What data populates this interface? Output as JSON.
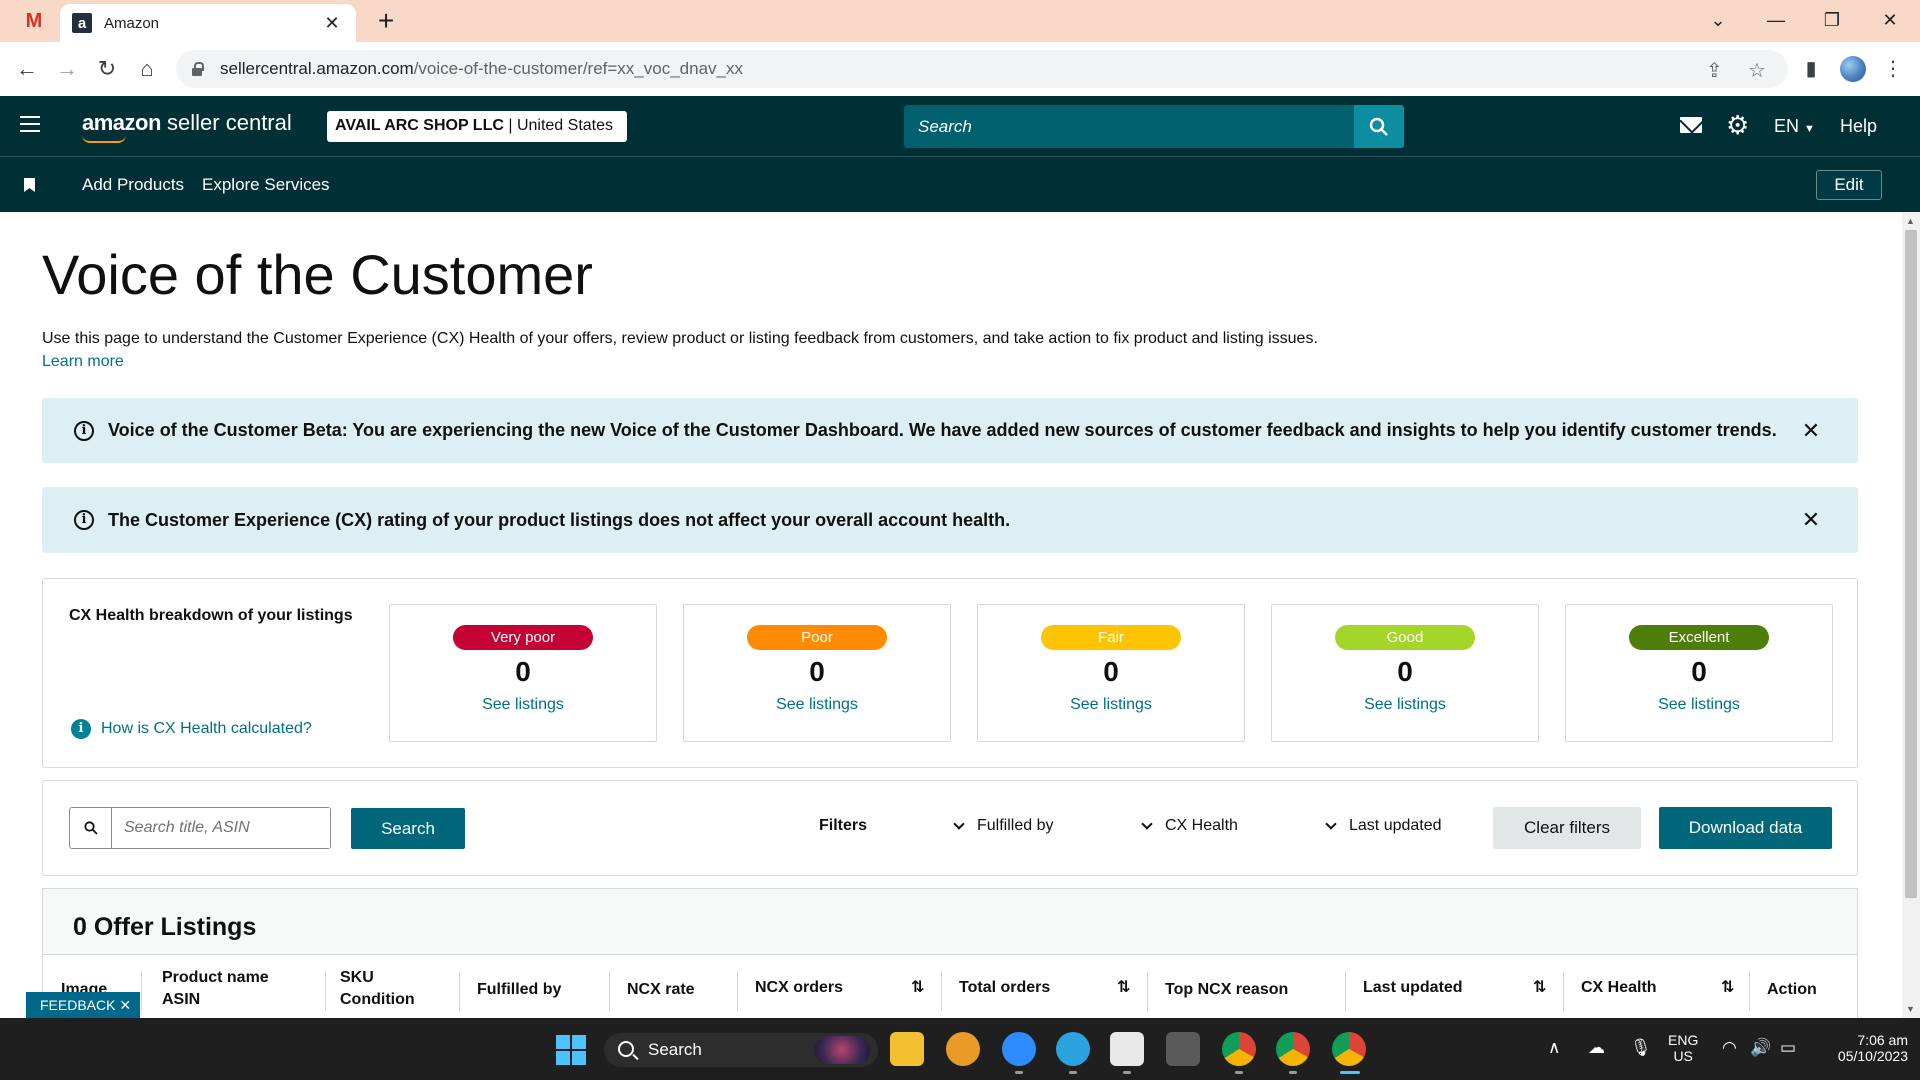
{
  "browser": {
    "tab_title": "Amazon",
    "favicon_letter": "a",
    "gmail_letter": "M",
    "url_host": "sellercentral.amazon.com",
    "url_path": "/voice-of-the-customer/ref=xx_voc_dnav_xx"
  },
  "header": {
    "logo_brand": "amazon",
    "logo_suffix": " seller central",
    "account_name": "AVAIL ARC SHOP LLC",
    "account_region": " | United States",
    "search_placeholder": "Search",
    "language": "EN",
    "help": "Help"
  },
  "subnav": {
    "links": [
      "Add Products",
      "Explore Services"
    ],
    "edit": "Edit"
  },
  "page": {
    "title": "Voice of the Customer",
    "intro": "Use this page to understand the Customer Experience (CX) Health of your offers, review product or listing feedback from customers, and take action to fix product and listing issues.",
    "learn_more": "Learn more"
  },
  "alerts": [
    {
      "text": "Voice of the Customer Beta: You are experiencing the new Voice of the Customer Dashboard. We have added new sources of customer feedback and insights to help you identify customer trends."
    },
    {
      "text": "The Customer Experience (CX) rating of your product listings does not affect your overall account health."
    }
  ],
  "cx_health": {
    "title": "CX Health breakdown of your listings",
    "how_link": "How is CX Health calculated?",
    "cards": [
      {
        "label": "Very poor",
        "count": "0",
        "link": "See listings",
        "color": "#c40233"
      },
      {
        "label": "Poor",
        "count": "0",
        "link": "See listings",
        "color": "#ff8c00"
      },
      {
        "label": "Fair",
        "count": "0",
        "link": "See listings",
        "color": "#ffc400"
      },
      {
        "label": "Good",
        "count": "0",
        "link": "See listings",
        "color": "#a4d629"
      },
      {
        "label": "Excellent",
        "count": "0",
        "link": "See listings",
        "color": "#4f7d0a"
      }
    ]
  },
  "filters": {
    "search_placeholder": "Search title, ASIN",
    "search_button": "Search",
    "label": "Filters",
    "dropdowns": [
      "Fulfilled by",
      "CX Health",
      "Last updated"
    ],
    "clear": "Clear filters",
    "download": "Download data"
  },
  "listings": {
    "heading": "0 Offer Listings",
    "columns": {
      "image": "Image",
      "product_name": "Product name",
      "asin": "ASIN",
      "sku": "SKU",
      "condition": "Condition",
      "fulfilled_by": "Fulfilled by",
      "ncx_rate": "NCX rate",
      "ncx_orders": "NCX orders",
      "total_orders": "Total orders",
      "top_ncx_reason": "Top NCX reason",
      "last_updated": "Last updated",
      "cx_health": "CX Health",
      "action": "Action"
    }
  },
  "feedback": "FEEDBACK",
  "taskbar": {
    "search": "Search",
    "lang_top": "ENG",
    "lang_bottom": "US",
    "time": "7:06 am",
    "date": "05/10/2023"
  },
  "colors": {
    "header_bg": "#002f36",
    "link": "#007185",
    "primary_button": "#00667a",
    "alert_bg": "#ddeff2"
  }
}
